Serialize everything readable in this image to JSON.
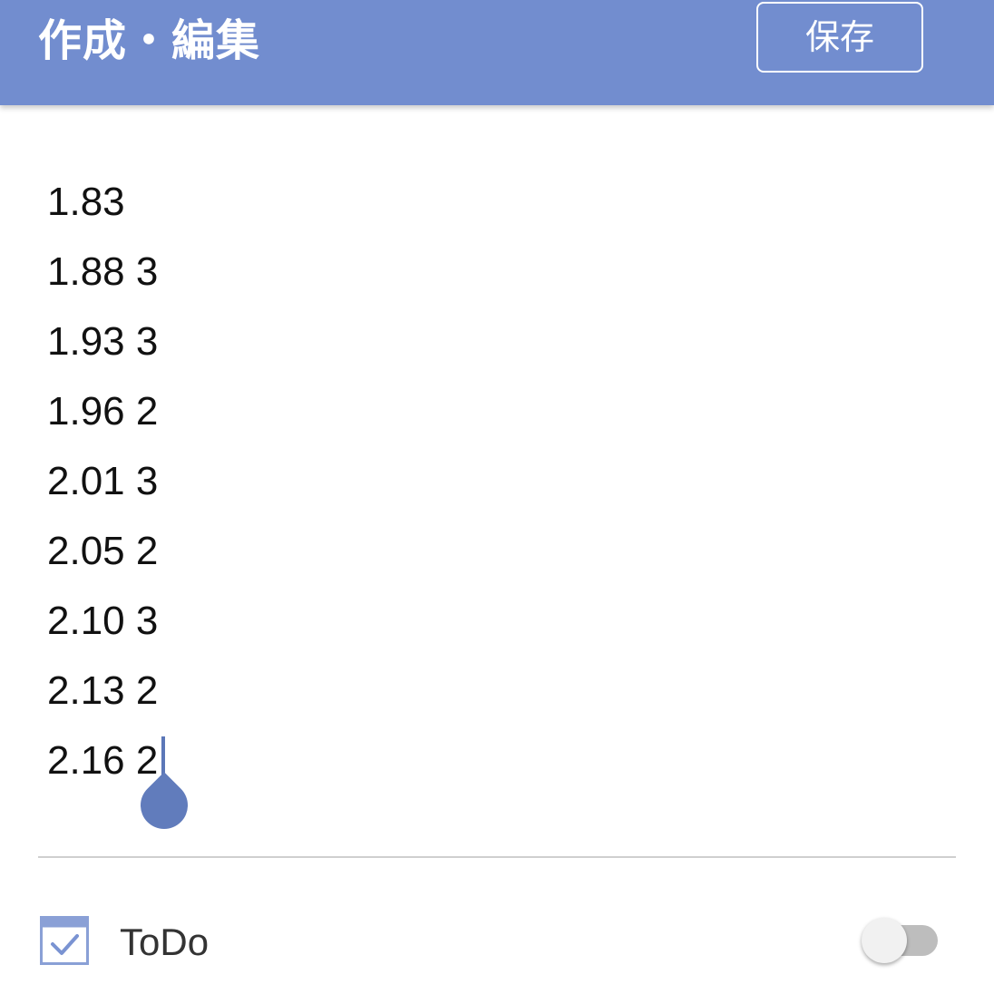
{
  "appbar": {
    "title": "作成・編集",
    "save_label": "保存",
    "background": "#728dcf"
  },
  "editor": {
    "lines": [
      "1.83",
      "1.88 3",
      "1.93 3",
      "1.96 2",
      "2.01 3",
      "2.05 2",
      "2.10 3",
      "2.13 2",
      "2.16 2"
    ],
    "caret_color": "#5c77b8"
  },
  "todo": {
    "label": "ToDo",
    "icon": "checkbox-calendar-icon",
    "enabled": false
  }
}
